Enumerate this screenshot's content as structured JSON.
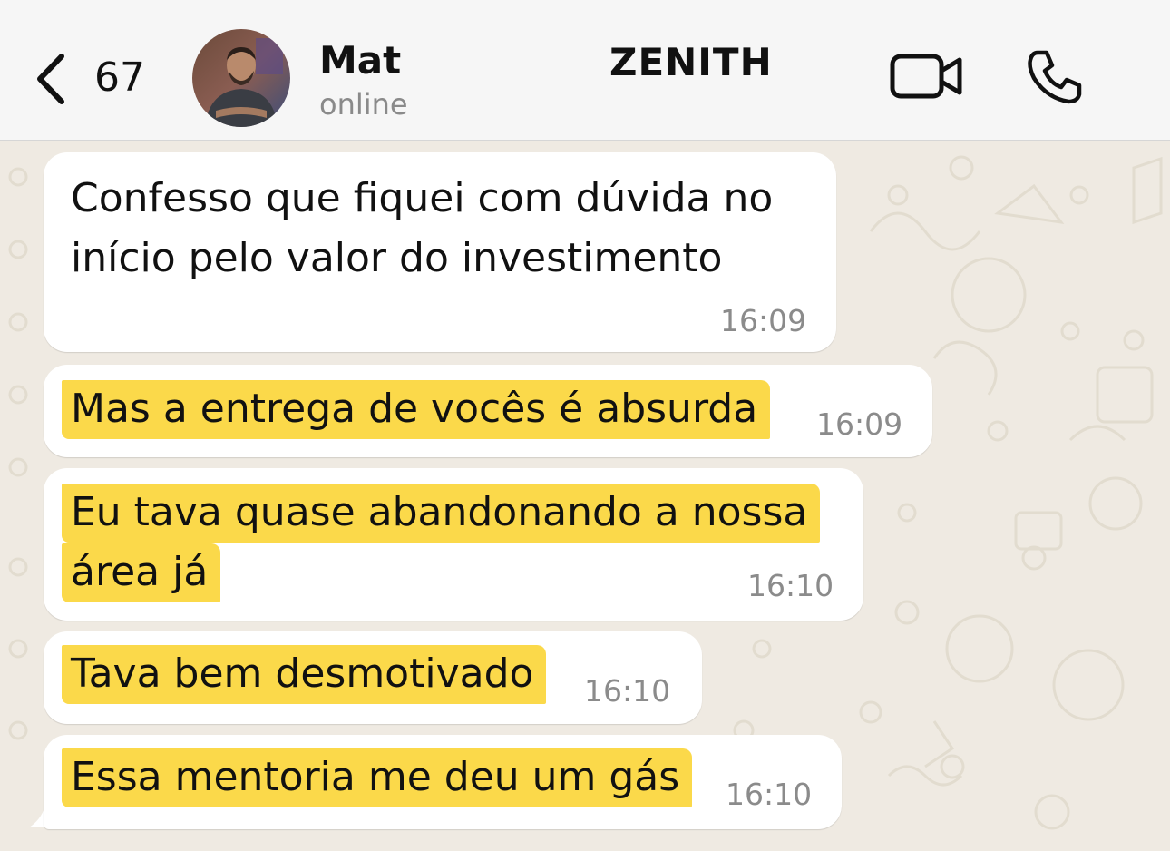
{
  "header": {
    "back_count": "67",
    "contact_name": "Mat",
    "contact_status": "online",
    "brand": "ZENITH",
    "icons": [
      "chevron-left-icon",
      "avatar-photo",
      "video-camera-icon",
      "phone-icon"
    ]
  },
  "messages": [
    {
      "lines": [
        "Confesso que fiquei com dúvida no",
        "início pelo valor do investimento"
      ],
      "time": "16:09",
      "highlighted": false
    },
    {
      "lines": [
        "Mas a entrega de vocês é absurda"
      ],
      "time": "16:09",
      "highlighted": true
    },
    {
      "lines": [
        "Eu tava quase abandonando a nossa",
        "área já"
      ],
      "time": "16:10",
      "highlighted": true
    },
    {
      "lines": [
        "Tava bem desmotivado"
      ],
      "time": "16:10",
      "highlighted": true
    },
    {
      "lines": [
        "Essa mentoria me deu um gás"
      ],
      "time": "16:10",
      "highlighted": true
    }
  ],
  "colors": {
    "highlight": "#fbd94a",
    "chat_background": "#efeae2",
    "bubble": "#ffffff",
    "header": "#f6f6f6"
  }
}
